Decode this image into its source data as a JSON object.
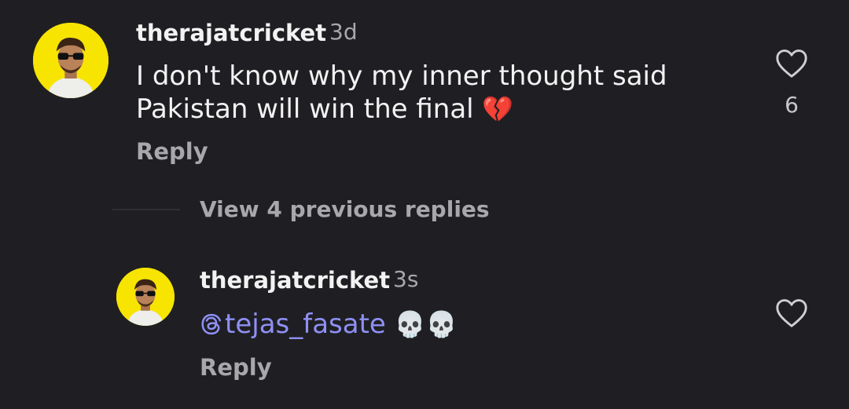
{
  "comment": {
    "username": "therajatcricket",
    "time": "3d",
    "text_line1": "I don't know why my inner thought said",
    "text_line2": "Pakistan will win the final",
    "emoji": "💔",
    "reply_label": "Reply",
    "like_count": "6",
    "like_icon": "heart-outline-icon"
  },
  "thread": {
    "view_replies_label": "View 4 previous replies"
  },
  "reply": {
    "username": "therajatcricket",
    "time": "3s",
    "mention": "tejas_fasate",
    "emojis": "💀💀",
    "reply_label": "Reply",
    "like_icon": "heart-outline-icon"
  },
  "colors": {
    "background": "#1f1f23",
    "mention": "#8f90f5",
    "avatar_bg": "#f7e400"
  }
}
